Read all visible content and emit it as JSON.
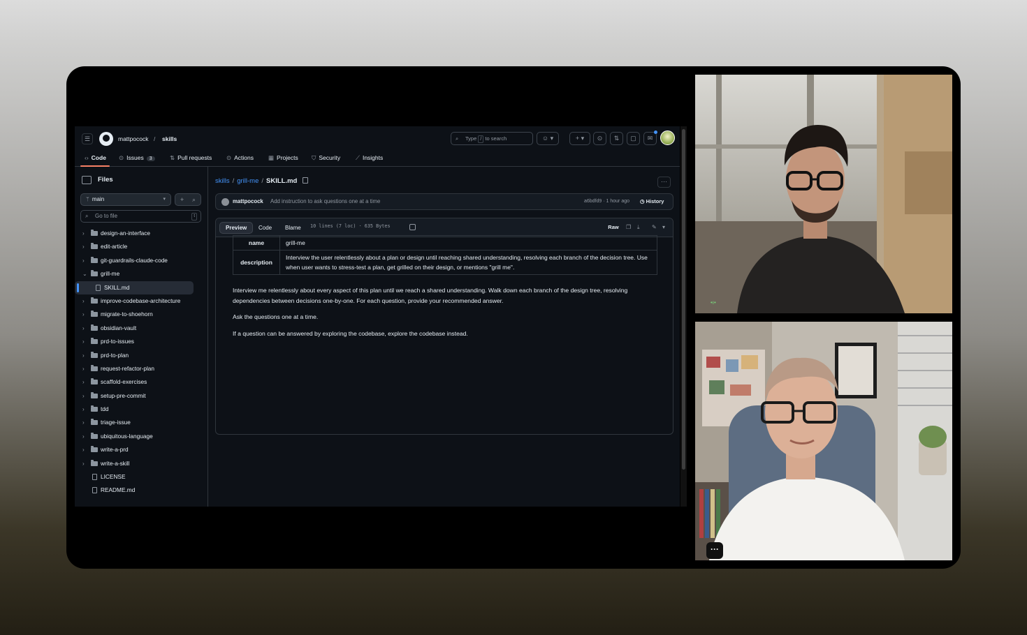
{
  "github": {
    "owner": "mattpocock",
    "repo": "skills",
    "search_placeholder": "Type",
    "search_key": "/",
    "search_suffix": "to search",
    "tabs": [
      {
        "label": "Code"
      },
      {
        "label": "Issues",
        "count": "3"
      },
      {
        "label": "Pull requests"
      },
      {
        "label": "Actions"
      },
      {
        "label": "Projects"
      },
      {
        "label": "Security"
      },
      {
        "label": "Insights"
      }
    ]
  },
  "sidebar": {
    "title": "Files",
    "branch": "main",
    "goto_placeholder": "Go to file",
    "goto_key": "t",
    "tree": [
      {
        "label": "design-an-interface",
        "type": "folder"
      },
      {
        "label": "edit-article",
        "type": "folder"
      },
      {
        "label": "git-guardrails-claude-code",
        "type": "folder"
      },
      {
        "label": "grill-me",
        "type": "folder-open"
      },
      {
        "label": "SKILL.md",
        "type": "file-nested"
      },
      {
        "label": "improve-codebase-architecture",
        "type": "folder"
      },
      {
        "label": "migrate-to-shoehorn",
        "type": "folder"
      },
      {
        "label": "obsidian-vault",
        "type": "folder"
      },
      {
        "label": "prd-to-issues",
        "type": "folder"
      },
      {
        "label": "prd-to-plan",
        "type": "folder"
      },
      {
        "label": "request-refactor-plan",
        "type": "folder"
      },
      {
        "label": "scaffold-exercises",
        "type": "folder"
      },
      {
        "label": "setup-pre-commit",
        "type": "folder"
      },
      {
        "label": "tdd",
        "type": "folder"
      },
      {
        "label": "triage-issue",
        "type": "folder"
      },
      {
        "label": "ubiquitous-language",
        "type": "folder"
      },
      {
        "label": "write-a-prd",
        "type": "folder"
      },
      {
        "label": "write-a-skill",
        "type": "folder"
      },
      {
        "label": "LICENSE",
        "type": "file"
      },
      {
        "label": "README.md",
        "type": "file"
      }
    ]
  },
  "file": {
    "path": [
      "skills",
      "grill-me",
      "SKILL.md"
    ],
    "commit_author": "mattpocock",
    "commit_message": "Add instruction to ask questions one at a time",
    "commit_sha": "a6bdfd9 · 1 hour ago",
    "history_label": "History",
    "view_tabs": [
      "Preview",
      "Code",
      "Blame"
    ],
    "meta": "10 lines (7 loc) · 635 Bytes",
    "raw_label": "Raw",
    "frontmatter": [
      {
        "key": "name",
        "value": "grill-me"
      },
      {
        "key": "description",
        "value": "Interview the user relentlessly about a plan or design until reaching shared understanding, resolving each branch of the decision tree. Use when user wants to stress-test a plan, get grilled on their design, or mentions \"grill me\"."
      }
    ],
    "paragraphs": [
      "Interview me relentlessly about every aspect of this plan until we reach a shared understanding. Walk down each branch of the design tree, resolving dependencies between decisions one-by-one. For each question, provide your recommended answer.",
      "Ask the questions one at a time.",
      "If a question can be answered by exploring the codebase, explore the codebase instead."
    ]
  },
  "colors": {
    "accent_link": "#4493f8",
    "tab_underline": "#f78166",
    "gh_bg": "#0d1117"
  }
}
